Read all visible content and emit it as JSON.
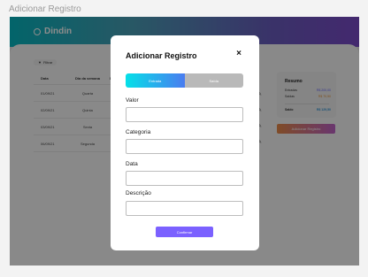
{
  "frame_title": "Adicionar Registro",
  "header": {
    "logo_text": "Dindin"
  },
  "toolbar": {
    "filter_label": "Filtrar"
  },
  "table": {
    "headers": [
      "Data",
      "Dia da semana",
      "Descrição"
    ],
    "rows": [
      {
        "date": "01/09/21",
        "weekday": "Quarta"
      },
      {
        "date": "02/09/21",
        "weekday": "Quinta"
      },
      {
        "date": "03/09/21",
        "weekday": "Sexta"
      },
      {
        "date": "06/09/21",
        "weekday": "Segunda"
      }
    ]
  },
  "summary": {
    "title": "Resumo",
    "entradas_label": "Entradas",
    "entradas_value": "R$ 200,00",
    "saidas_label": "Saídas",
    "saidas_value": "R$ 70,50",
    "saldo_label": "Saldo",
    "saldo_value": "R$ 129,50"
  },
  "add_button": "Adicionar Registro",
  "modal": {
    "title": "Adicionar Registro",
    "close": "×",
    "toggle_entrada": "Entrada",
    "toggle_saida": "Saída",
    "valor_label": "Valor",
    "categoria_label": "Categoria",
    "data_label": "Data",
    "descricao_label": "Descrição",
    "confirm_label": "Confirmar"
  },
  "colors": {
    "accent": "#7b61ff",
    "entradas": "#6c6cff",
    "saidas": "#e8963c",
    "brand_start": "#05b7c1",
    "brand_end": "#7b4bc9"
  }
}
